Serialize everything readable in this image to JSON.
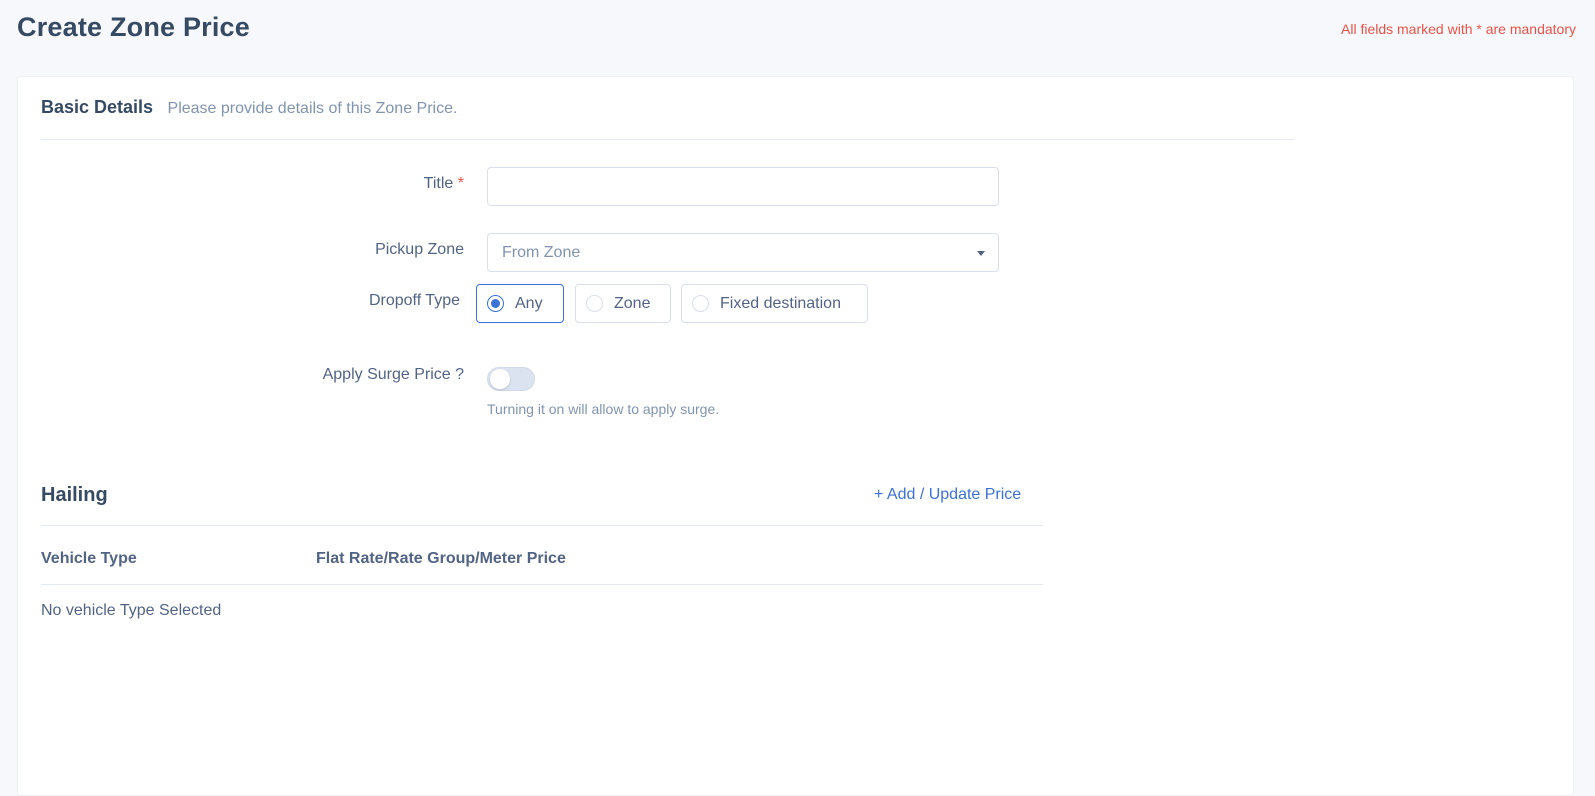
{
  "header": {
    "title": "Create Zone Price",
    "mandatory_note": "All fields marked with * are mandatory"
  },
  "basic_details": {
    "title": "Basic Details",
    "subtitle": "Please provide details of this Zone Price.",
    "title_field": {
      "label": "Title",
      "required_mark": "*",
      "value": ""
    },
    "pickup_zone": {
      "label": "Pickup Zone",
      "placeholder": "From Zone"
    },
    "dropoff_type": {
      "label": "Dropoff Type",
      "options": [
        "Any",
        "Zone",
        "Fixed destination"
      ],
      "selected": "Any"
    },
    "surge": {
      "label": "Apply Surge Price ?",
      "enabled": false,
      "hint": "Turning it on will allow to apply surge."
    }
  },
  "hailing": {
    "title": "Hailing",
    "add_link": "+ Add / Update Price",
    "columns": [
      "Vehicle Type",
      "Flat Rate/Rate Group/Meter Price"
    ],
    "empty_text": "No vehicle Type Selected"
  },
  "colors": {
    "accent": "#3c72d6",
    "required": "#e85347",
    "heading": "#364a63",
    "text": "#526484",
    "muted": "#8094ae"
  }
}
